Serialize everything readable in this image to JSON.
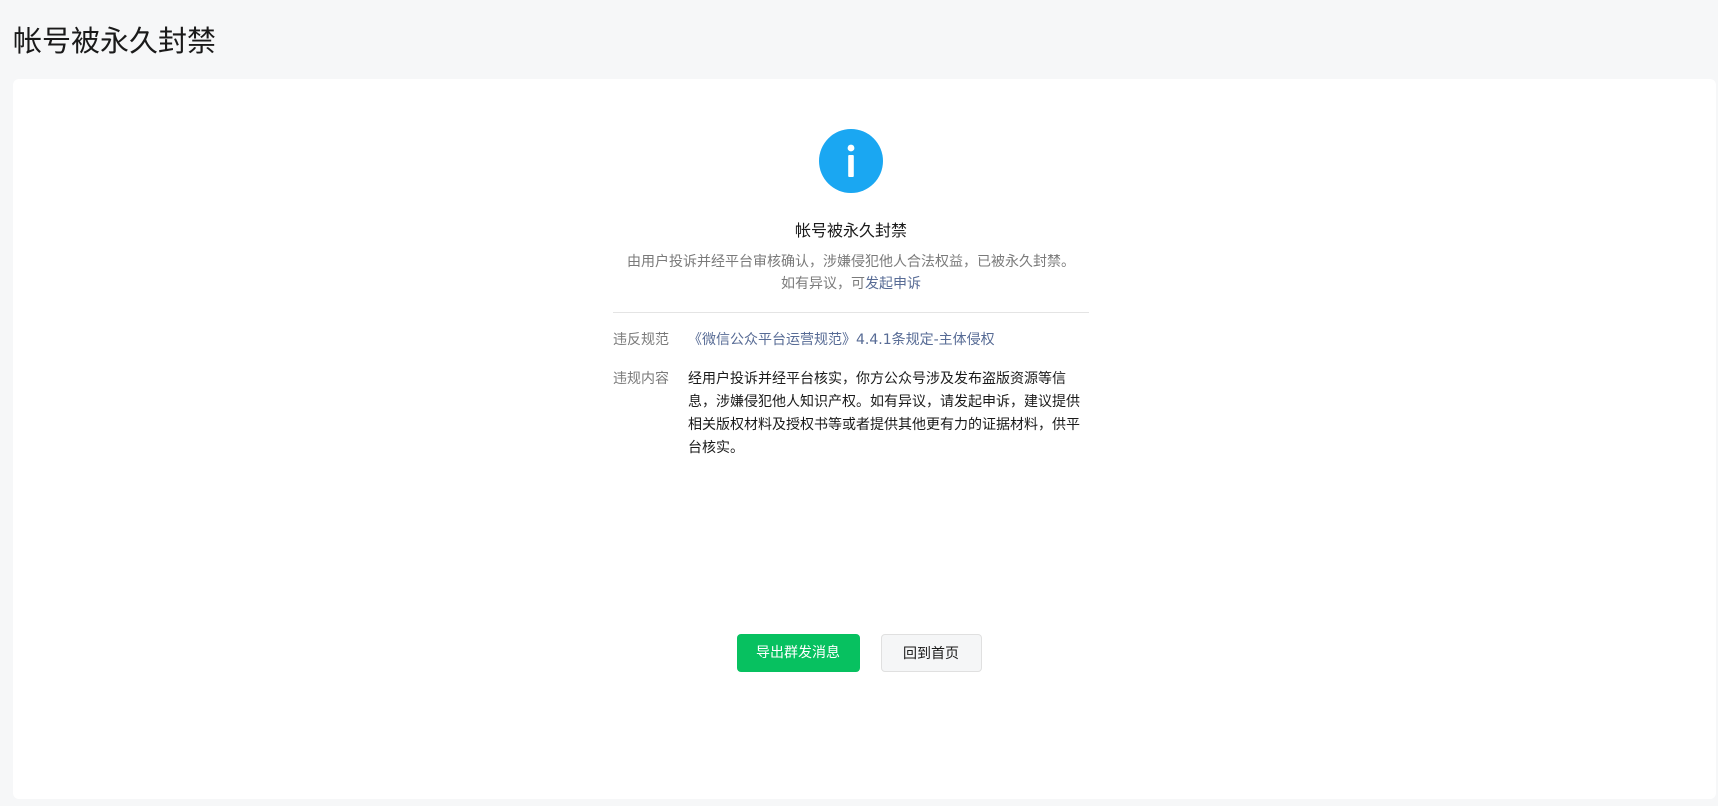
{
  "page": {
    "title": "帐号被永久封禁"
  },
  "result": {
    "title": "帐号被永久封禁",
    "description": "由用户投诉并经平台审核确认，涉嫌侵犯他人合法权益，已被永久封禁。",
    "appeal_prefix": "如有异议，可",
    "appeal_link": "发起申诉",
    "icon": "info-icon",
    "icon_color": "#1aa7f2"
  },
  "details": {
    "rule_label": "违反规范",
    "rule_value": "《微信公众平台运营规范》4.4.1条规定-主体侵权",
    "content_label": "违规内容",
    "content_value": "经用户投诉并经平台核实，你方公众号涉及发布盗版资源等信息，涉嫌侵犯他人知识产权。如有异议，请发起申诉，建议提供相关版权材料及授权书等或者提供其他更有力的证据材料，供平台核实。"
  },
  "actions": {
    "export_label": "导出群发消息",
    "home_label": "回到首页",
    "primary_color": "#07c160"
  },
  "colors": {
    "link": "#576b95",
    "background": "#f6f7f8"
  }
}
